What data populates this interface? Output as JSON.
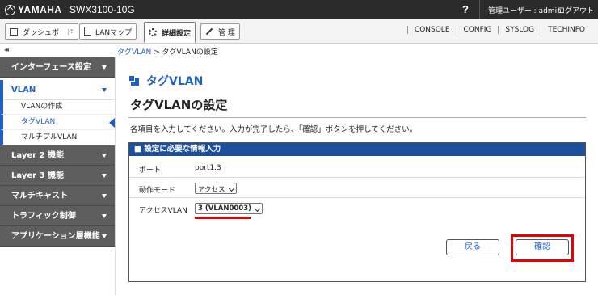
{
  "header": {
    "brand": "YAMAHA",
    "model": "SWX3100-10G",
    "help": "?",
    "user_label": "管理ユーザー : admin",
    "logout": "ログアウト"
  },
  "toolbar": {
    "dashboard": "ダッシュボード",
    "lanmap": "LANマップ",
    "advanced": "詳細設定",
    "manage": "管 理",
    "links": [
      "CONSOLE",
      "CONFIG",
      "SYSLOG",
      "TECHINFO"
    ]
  },
  "subbar": {
    "collapse": "◂◂",
    "breadcrumb_link": "タグVLAN",
    "breadcrumb_sep": " > ",
    "breadcrumb_current": "タグVLANの設定"
  },
  "sidebar": {
    "sections": [
      {
        "label": "インターフェース設定"
      },
      {
        "label": "VLAN"
      },
      {
        "label": "Layer 2 機能"
      },
      {
        "label": "Layer 3 機能"
      },
      {
        "label": "マルチキャスト"
      },
      {
        "label": "トラフィック制御"
      },
      {
        "label": "アプリケーション層機能"
      }
    ],
    "vlan_items": [
      {
        "label": "VLANの作成"
      },
      {
        "label": "タグVLAN"
      },
      {
        "label": "マルチプルVLAN"
      }
    ]
  },
  "main": {
    "heading": "タグVLAN",
    "title": "タグVLANの設定",
    "instruction": "各項目を入力してください。入力が完了したら、「確認」ボタンを押してください。",
    "panel_title": "■ 設定に必要な情報入力",
    "rows": [
      {
        "label": "ポート",
        "value": "port1.3"
      },
      {
        "label": "動作モード",
        "value": "アクセス"
      },
      {
        "label": "アクセスVLAN",
        "value": "3 (VLAN0003)"
      }
    ],
    "back_button": "戻る",
    "confirm_button": "確認"
  },
  "colors": {
    "accent": "#1f5fbf",
    "panel_header": "#1c4f9c",
    "highlight": "#e60000",
    "topbar": "#2b2b2b",
    "sidebar_section": "#5e5e5e"
  }
}
